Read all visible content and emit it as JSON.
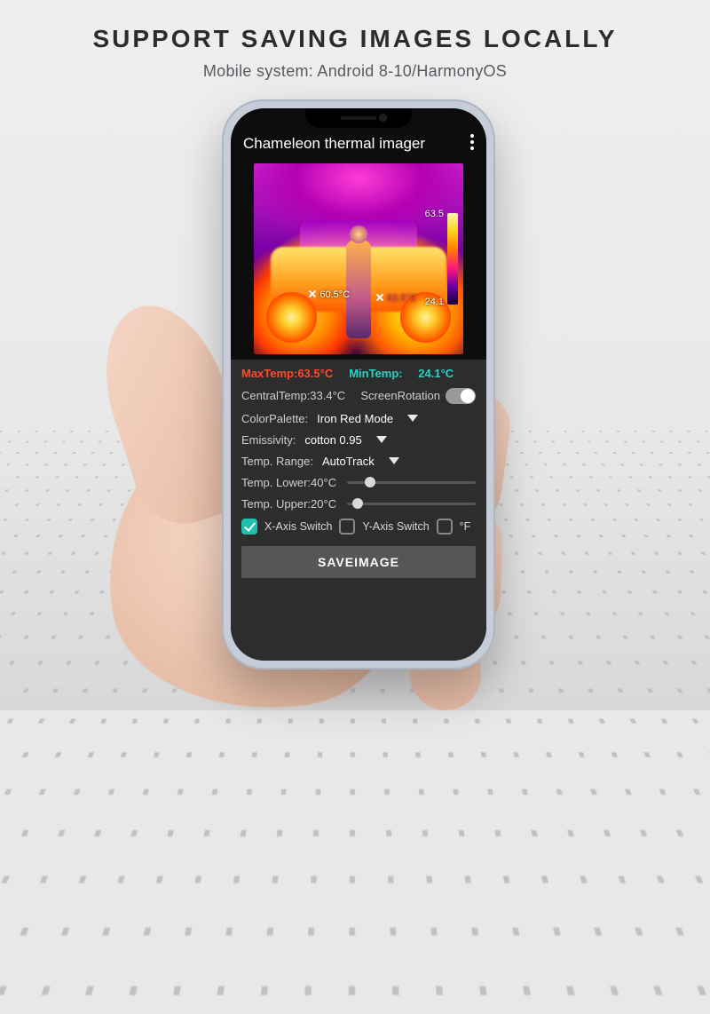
{
  "marketing": {
    "headline": "SUPPORT SAVING IMAGES LOCALLY",
    "subhead": "Mobile system: Android 8-10/HarmonyOS"
  },
  "app": {
    "title": "Chameleon thermal imager"
  },
  "thermal": {
    "scale_top": "63.5",
    "scale_bottom": "24.1",
    "marker_low": "60.5°C",
    "marker_high": "63.5°C"
  },
  "readout": {
    "max_label": "MaxTemp:63.5°C",
    "min_label": "MinTemp:",
    "min_value": "24.1°C",
    "central_label": "CentralTemp:33.4°C",
    "rotation_label": "ScreenRotation"
  },
  "settings": {
    "palette_label": "ColorPalette:",
    "palette_value": "Iron Red Mode",
    "emissivity_label": "Emissivity:",
    "emissivity_value": "cotton 0.95",
    "range_label": "Temp. Range:",
    "range_value": "AutoTrack",
    "lower_label": "Temp. Lower:40°C",
    "upper_label": "Temp. Upper:20°C"
  },
  "checks": {
    "x_label": "X-Axis Switch",
    "y_label": "Y-Axis Switch",
    "f_label": "°F"
  },
  "save_label": "SAVEIMAGE"
}
